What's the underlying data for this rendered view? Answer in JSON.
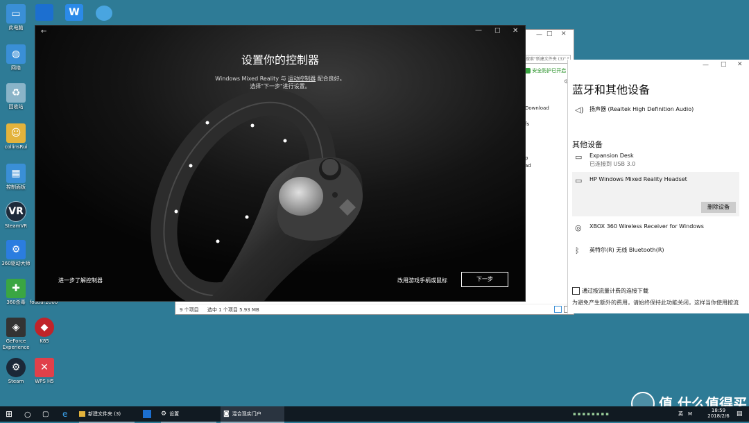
{
  "desktop_icons": [
    {
      "label": "此电脑",
      "icon": "computer-icon",
      "color": "#3a8fd6"
    },
    {
      "label": "网络",
      "icon": "network-icon",
      "color": "#3a8fd6"
    },
    {
      "label": "回收站",
      "icon": "recycle-bin-icon",
      "color": "#8ab4c8"
    },
    {
      "label": "collinsRui",
      "icon": "user-folder-icon",
      "color": "#e3b33c"
    },
    {
      "label": "控制面板",
      "icon": "control-panel-icon",
      "color": "#3a8fd6"
    },
    {
      "label": "SteamVR",
      "icon": "steamvr-icon",
      "color": "#1d2a3a"
    },
    {
      "label": "360驱动大师",
      "icon": "driver-master-icon",
      "color": "#2b7de0"
    },
    {
      "label": "360杀毒",
      "icon": "antivirus-icon",
      "color": "#3aa642"
    },
    {
      "label": "GeForce Experience",
      "icon": "geforce-icon",
      "color": "#333333"
    },
    {
      "label": "Steam",
      "icon": "steam-icon",
      "color": "#1b2838"
    },
    {
      "label": "K85",
      "icon": "k85-icon",
      "color": "#c0242a"
    },
    {
      "label": "WPS H5",
      "icon": "wps-h5-icon",
      "color": "#e0404a"
    },
    {
      "label": "foobar2000",
      "icon": "foobar-icon",
      "color": "#555555"
    }
  ],
  "explorer": {
    "search_placeholder": "搜索\"新建文件夹 (3)\"",
    "security_badge": "安全防护已开启",
    "side_items": [
      "Download",
      "fs",
      "p",
      "ad"
    ],
    "status_count": "9 个项目",
    "status_selected": "选中 1 个项目  5.93 MB"
  },
  "settings": {
    "heading": "蓝牙和其他设备",
    "audio_device": "扬声器 (Realtek High Definition Audio)",
    "other_devices_heading": "其他设备",
    "devices": [
      {
        "name": "Expansion Desk",
        "sub": "已连接到 USB 3.0",
        "icon": "usb-drive-icon"
      },
      {
        "name": "HP Windows Mixed Reality Headset",
        "sub": "",
        "icon": "headset-icon"
      },
      {
        "name": "XBOX 360 Wireless Receiver for Windows",
        "sub": "",
        "icon": "gamepad-icon"
      },
      {
        "name": "英特尔(R) 无线 Bluetooth(R)",
        "sub": "",
        "icon": "bluetooth-icon"
      }
    ],
    "remove_button": "删除设备",
    "metered_checkbox_label": "通过按流量计费的连接下载",
    "metered_desc": "为避免产生额外的费用，请始终保持此功能关闭，这样当你使用按流"
  },
  "portal": {
    "title": "设置你的控制器",
    "line1_prefix": "Windows Mixed Reality 与 ",
    "line1_link": "运动控制器",
    "line1_suffix": " 配合良好。",
    "line2": "选择\"下一步\"进行设置。",
    "learn_more": "进一步了解控制器",
    "alt_link": "改用游戏手柄或鼠标",
    "next_button": "下一步"
  },
  "taskbar": {
    "items": [
      {
        "label": "新建文件夹 (3)",
        "icon": "folder-icon"
      },
      {
        "label": "设置",
        "icon": "gear-icon"
      },
      {
        "label": "混合现实门户",
        "icon": "mixed-reality-icon"
      }
    ],
    "clock_time": "18:59",
    "clock_date": "2018/2/6",
    "ime": "英",
    "ime2": "M"
  },
  "watermark": "值 什么值得买"
}
